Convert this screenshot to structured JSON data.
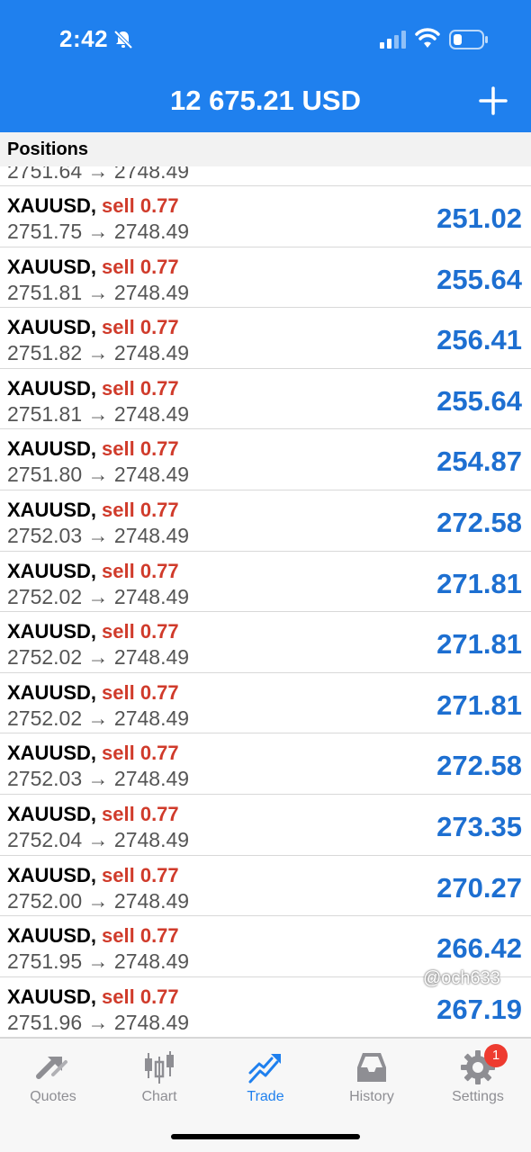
{
  "status_bar": {
    "time": "2:42"
  },
  "header": {
    "balance": "12 675.21 USD"
  },
  "section": {
    "title": "Positions"
  },
  "partial_row": {
    "prices": "2751.64 → 2748.49"
  },
  "positions": [
    {
      "symbol": "XAUUSD",
      "side": "sell 0.77",
      "prices": "2751.75 → 2748.49",
      "profit": "251.02"
    },
    {
      "symbol": "XAUUSD",
      "side": "sell 0.77",
      "prices": "2751.81 → 2748.49",
      "profit": "255.64"
    },
    {
      "symbol": "XAUUSD",
      "side": "sell 0.77",
      "prices": "2751.82 → 2748.49",
      "profit": "256.41"
    },
    {
      "symbol": "XAUUSD",
      "side": "sell 0.77",
      "prices": "2751.81 → 2748.49",
      "profit": "255.64"
    },
    {
      "symbol": "XAUUSD",
      "side": "sell 0.77",
      "prices": "2751.80 → 2748.49",
      "profit": "254.87"
    },
    {
      "symbol": "XAUUSD",
      "side": "sell 0.77",
      "prices": "2752.03 → 2748.49",
      "profit": "272.58"
    },
    {
      "symbol": "XAUUSD",
      "side": "sell 0.77",
      "prices": "2752.02 → 2748.49",
      "profit": "271.81"
    },
    {
      "symbol": "XAUUSD",
      "side": "sell 0.77",
      "prices": "2752.02 → 2748.49",
      "profit": "271.81"
    },
    {
      "symbol": "XAUUSD",
      "side": "sell 0.77",
      "prices": "2752.02 → 2748.49",
      "profit": "271.81"
    },
    {
      "symbol": "XAUUSD",
      "side": "sell 0.77",
      "prices": "2752.03 → 2748.49",
      "profit": "272.58"
    },
    {
      "symbol": "XAUUSD",
      "side": "sell 0.77",
      "prices": "2752.04 → 2748.49",
      "profit": "273.35"
    },
    {
      "symbol": "XAUUSD",
      "side": "sell 0.77",
      "prices": "2752.00 → 2748.49",
      "profit": "270.27"
    },
    {
      "symbol": "XAUUSD",
      "side": "sell 0.77",
      "prices": "2751.95 → 2748.49",
      "profit": "266.42"
    },
    {
      "symbol": "XAUUSD",
      "side": "sell 0.77",
      "prices": "2751.96 → 2748.49",
      "profit": "267.19"
    }
  ],
  "tabs": [
    {
      "label": "Quotes",
      "icon": "quotes-icon"
    },
    {
      "label": "Chart",
      "icon": "chart-icon"
    },
    {
      "label": "Trade",
      "icon": "trade-icon",
      "active": true
    },
    {
      "label": "History",
      "icon": "history-icon"
    },
    {
      "label": "Settings",
      "icon": "settings-icon",
      "badge": "1"
    }
  ],
  "watermark": "@och633",
  "colors": {
    "header": "#1f80ee",
    "sell": "#d03b2b",
    "profit": "#1d6fd1",
    "badge": "#ee3b30"
  }
}
